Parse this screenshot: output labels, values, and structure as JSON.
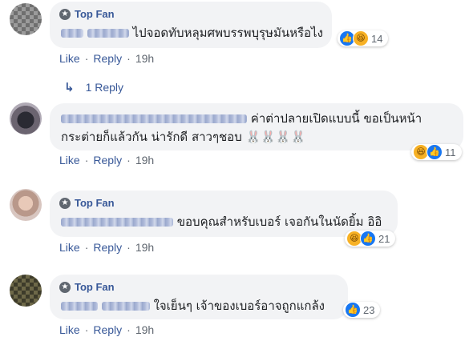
{
  "comments": [
    {
      "badge": "Top Fan",
      "text": "ไปจอดทับหลุมศพบรรพบุรุษมันหรือไง",
      "reaction_count": "14",
      "reactions": [
        "like-icon",
        "haha-icon"
      ],
      "actions": {
        "like": "Like",
        "reply": "Reply",
        "time": "19h"
      }
    },
    {
      "badge": "",
      "text_line1": "ค่าต่าปลายเปิดแบบนี้ ขอเป็นหน้า",
      "text_line2": "กระต่ายก็แล้วกัน น่ารักดี สาวๆชอบ 🐰🐰🐰🐰",
      "reaction_count": "11",
      "reactions": [
        "haha-icon",
        "like-icon"
      ],
      "actions": {
        "like": "Like",
        "reply": "Reply",
        "time": "19h"
      }
    },
    {
      "badge": "Top Fan",
      "text": "ขอบคุณสำหรับเบอร์ เจอกันในนัดยิ้ม อิอิ",
      "reaction_count": "21",
      "reactions": [
        "haha-icon",
        "like-icon"
      ],
      "actions": {
        "like": "Like",
        "reply": "Reply",
        "time": "19h"
      }
    },
    {
      "badge": "Top Fan",
      "text": "ใจเย็นๆ เจ้าของเบอร์อาจถูกแกล้ง",
      "reaction_count": "23",
      "reactions": [
        "like-icon"
      ],
      "actions": {
        "like": "Like",
        "reply": "Reply",
        "time": "19h"
      }
    }
  ],
  "replies_link": {
    "label": "1 Reply"
  },
  "colors": {
    "link": "#385898",
    "bubble": "#f2f3f5",
    "like": "#1877f2",
    "haha": "#f7b125"
  }
}
